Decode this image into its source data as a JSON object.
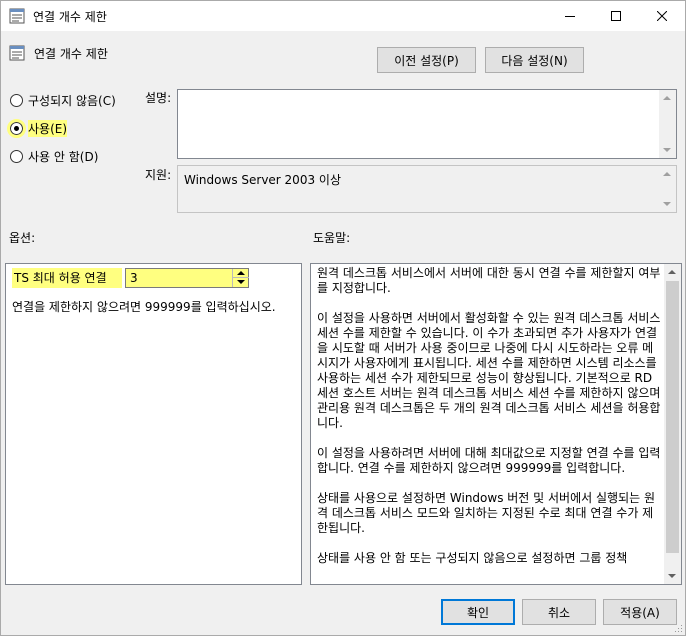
{
  "window": {
    "title": "연결 개수 제한",
    "minimize_icon": "minimize-icon",
    "maximize_icon": "maximize-icon",
    "close_icon": "close-icon"
  },
  "header": {
    "policy_name": "연결 개수 제한",
    "prev_button": "이전 설정(P)",
    "next_button": "다음 설정(N)"
  },
  "state": {
    "options": [
      {
        "label": "구성되지 않음(C)",
        "checked": false
      },
      {
        "label": "사용(E)",
        "checked": true
      },
      {
        "label": "사용 안 함(D)",
        "checked": false
      }
    ]
  },
  "comment": {
    "label": "설명:",
    "value": ""
  },
  "supported": {
    "label": "지원:",
    "value": "Windows Server 2003 이상"
  },
  "options_section": {
    "label": "옵션:",
    "ts_max_label": "TS 최대 허용 연결",
    "ts_max_value": "3",
    "note": "연결을 제한하지 않으려면 999999를 입력하십시오."
  },
  "help_section": {
    "label": "도움말:",
    "paragraphs": [
      "원격 데스크톱 서비스에서 서버에 대한 동시 연결 수를 제한할지 여부를 지정합니다.",
      "이 설정을 사용하면 서버에서 활성화할 수 있는 원격 데스크톱 서비스 세션 수를 제한할 수 있습니다. 이 수가 초과되면 추가 사용자가 연결을 시도할 때 서버가 사용 중이므로 나중에 다시 시도하라는 오류 메시지가 사용자에게 표시됩니다. 세션 수를 제한하면 시스템 리소스를 사용하는 세션 수가 제한되므로 성능이 향상됩니다. 기본적으로 RD 세션 호스트 서버는 원격 데스크톱 서비스 세션 수를 제한하지 않으며 관리용 원격 데스크톱은 두 개의 원격 데스크톱 서비스 세션을 허용합니다.",
      "이 설정을 사용하려면 서버에 대해 최대값으로 지정할 연결 수를 입력합니다. 연결 수를 제한하지 않으려면 999999를 입력합니다.",
      "상태를 사용으로 설정하면 Windows 버전 및 서버에서 실행되는 원격 데스크톱 서비스 모드와 일치하는 지정된 수로 최대 연결 수가 제한됩니다.",
      "상태를 사용 안 함 또는 구성되지 않음으로 설정하면 그룹 정책"
    ]
  },
  "footer": {
    "ok": "확인",
    "cancel": "취소",
    "apply": "적용(A)"
  }
}
